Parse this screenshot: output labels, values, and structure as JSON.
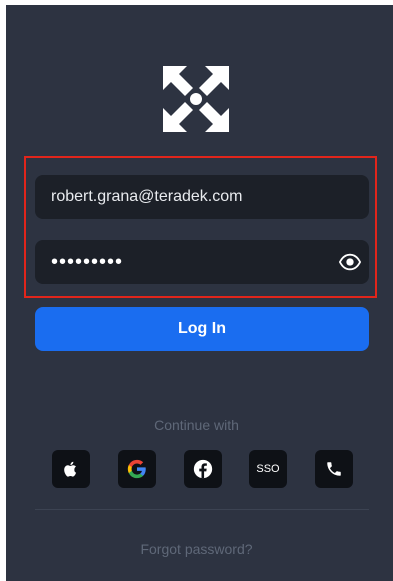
{
  "login": {
    "email_value": "robert.grana@teradek.com",
    "password_masked": "•••••••••",
    "login_label": "Log In",
    "continue_with": "Continue with",
    "forgot_password": "Forgot password?"
  },
  "social": {
    "sso_label": "SSO",
    "icons": [
      "apple-icon",
      "google-icon",
      "facebook-icon",
      "sso-icon",
      "phone-icon"
    ]
  },
  "colors": {
    "background": "#2d3341",
    "field": "#1c2028",
    "primary": "#1a6df0",
    "highlight": "#e1251b",
    "muted_text": "#5f6878"
  }
}
